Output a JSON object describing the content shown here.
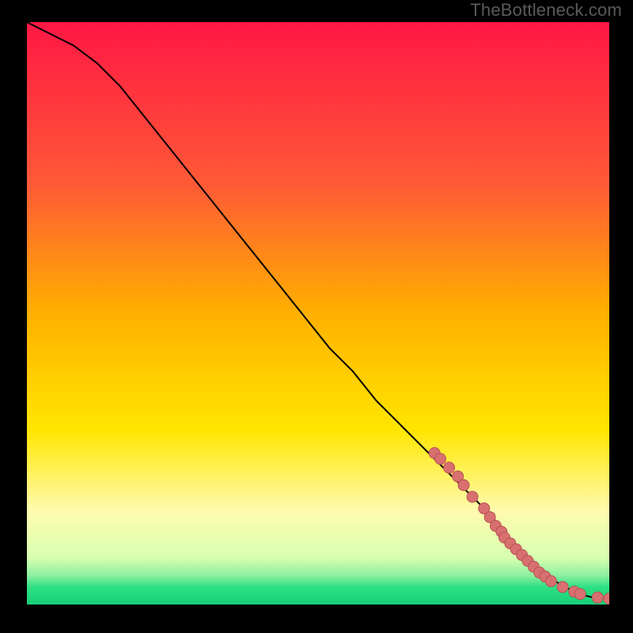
{
  "watermark": "TheBottleneck.com",
  "colors": {
    "gradient_stops": [
      {
        "offset": 0.0,
        "color": "#ff1744"
      },
      {
        "offset": 0.28,
        "color": "#ff5a36"
      },
      {
        "offset": 0.5,
        "color": "#ffb000"
      },
      {
        "offset": 0.7,
        "color": "#ffe600"
      },
      {
        "offset": 0.84,
        "color": "#fffbb0"
      },
      {
        "offset": 0.92,
        "color": "#d8ffb0"
      },
      {
        "offset": 0.95,
        "color": "#8cf0a0"
      },
      {
        "offset": 0.97,
        "color": "#2ee083"
      },
      {
        "offset": 1.0,
        "color": "#17cf7a"
      }
    ],
    "curve": "#000000",
    "marker_fill": "#d87070",
    "marker_stroke": "#b85252"
  },
  "chart_data": {
    "type": "line",
    "xlabel": "",
    "ylabel": "",
    "xlim": [
      0,
      100
    ],
    "ylim": [
      0,
      100
    ],
    "grid": false,
    "legend": false,
    "series": [
      {
        "name": "curve",
        "x": [
          0,
          4,
          8,
          12,
          16,
          20,
          24,
          28,
          32,
          36,
          40,
          44,
          48,
          52,
          56,
          60,
          64,
          68,
          72,
          76,
          80,
          83,
          86,
          88,
          90,
          92,
          94,
          96,
          98,
          100
        ],
        "y": [
          100,
          98,
          96,
          93,
          89,
          84,
          79,
          74,
          69,
          64,
          59,
          54,
          49,
          44,
          40,
          35,
          31,
          27,
          23,
          19,
          15,
          11,
          8,
          6,
          4.5,
          3.2,
          2.2,
          1.5,
          1,
          1
        ]
      }
    ],
    "scatter": {
      "name": "markers",
      "x": [
        70,
        71,
        72.5,
        74,
        75,
        76.5,
        78.5,
        79.5,
        80.5,
        81.5,
        82,
        83,
        84,
        85,
        86,
        87,
        88,
        89,
        90,
        92,
        94,
        95,
        98,
        100
      ],
      "y": [
        26,
        25,
        23.5,
        22,
        20.5,
        18.5,
        16.5,
        15,
        13.5,
        12.5,
        11.5,
        10.5,
        9.5,
        8.5,
        7.5,
        6.5,
        5.5,
        4.8,
        4,
        3,
        2.2,
        1.8,
        1.2,
        1
      ]
    }
  }
}
